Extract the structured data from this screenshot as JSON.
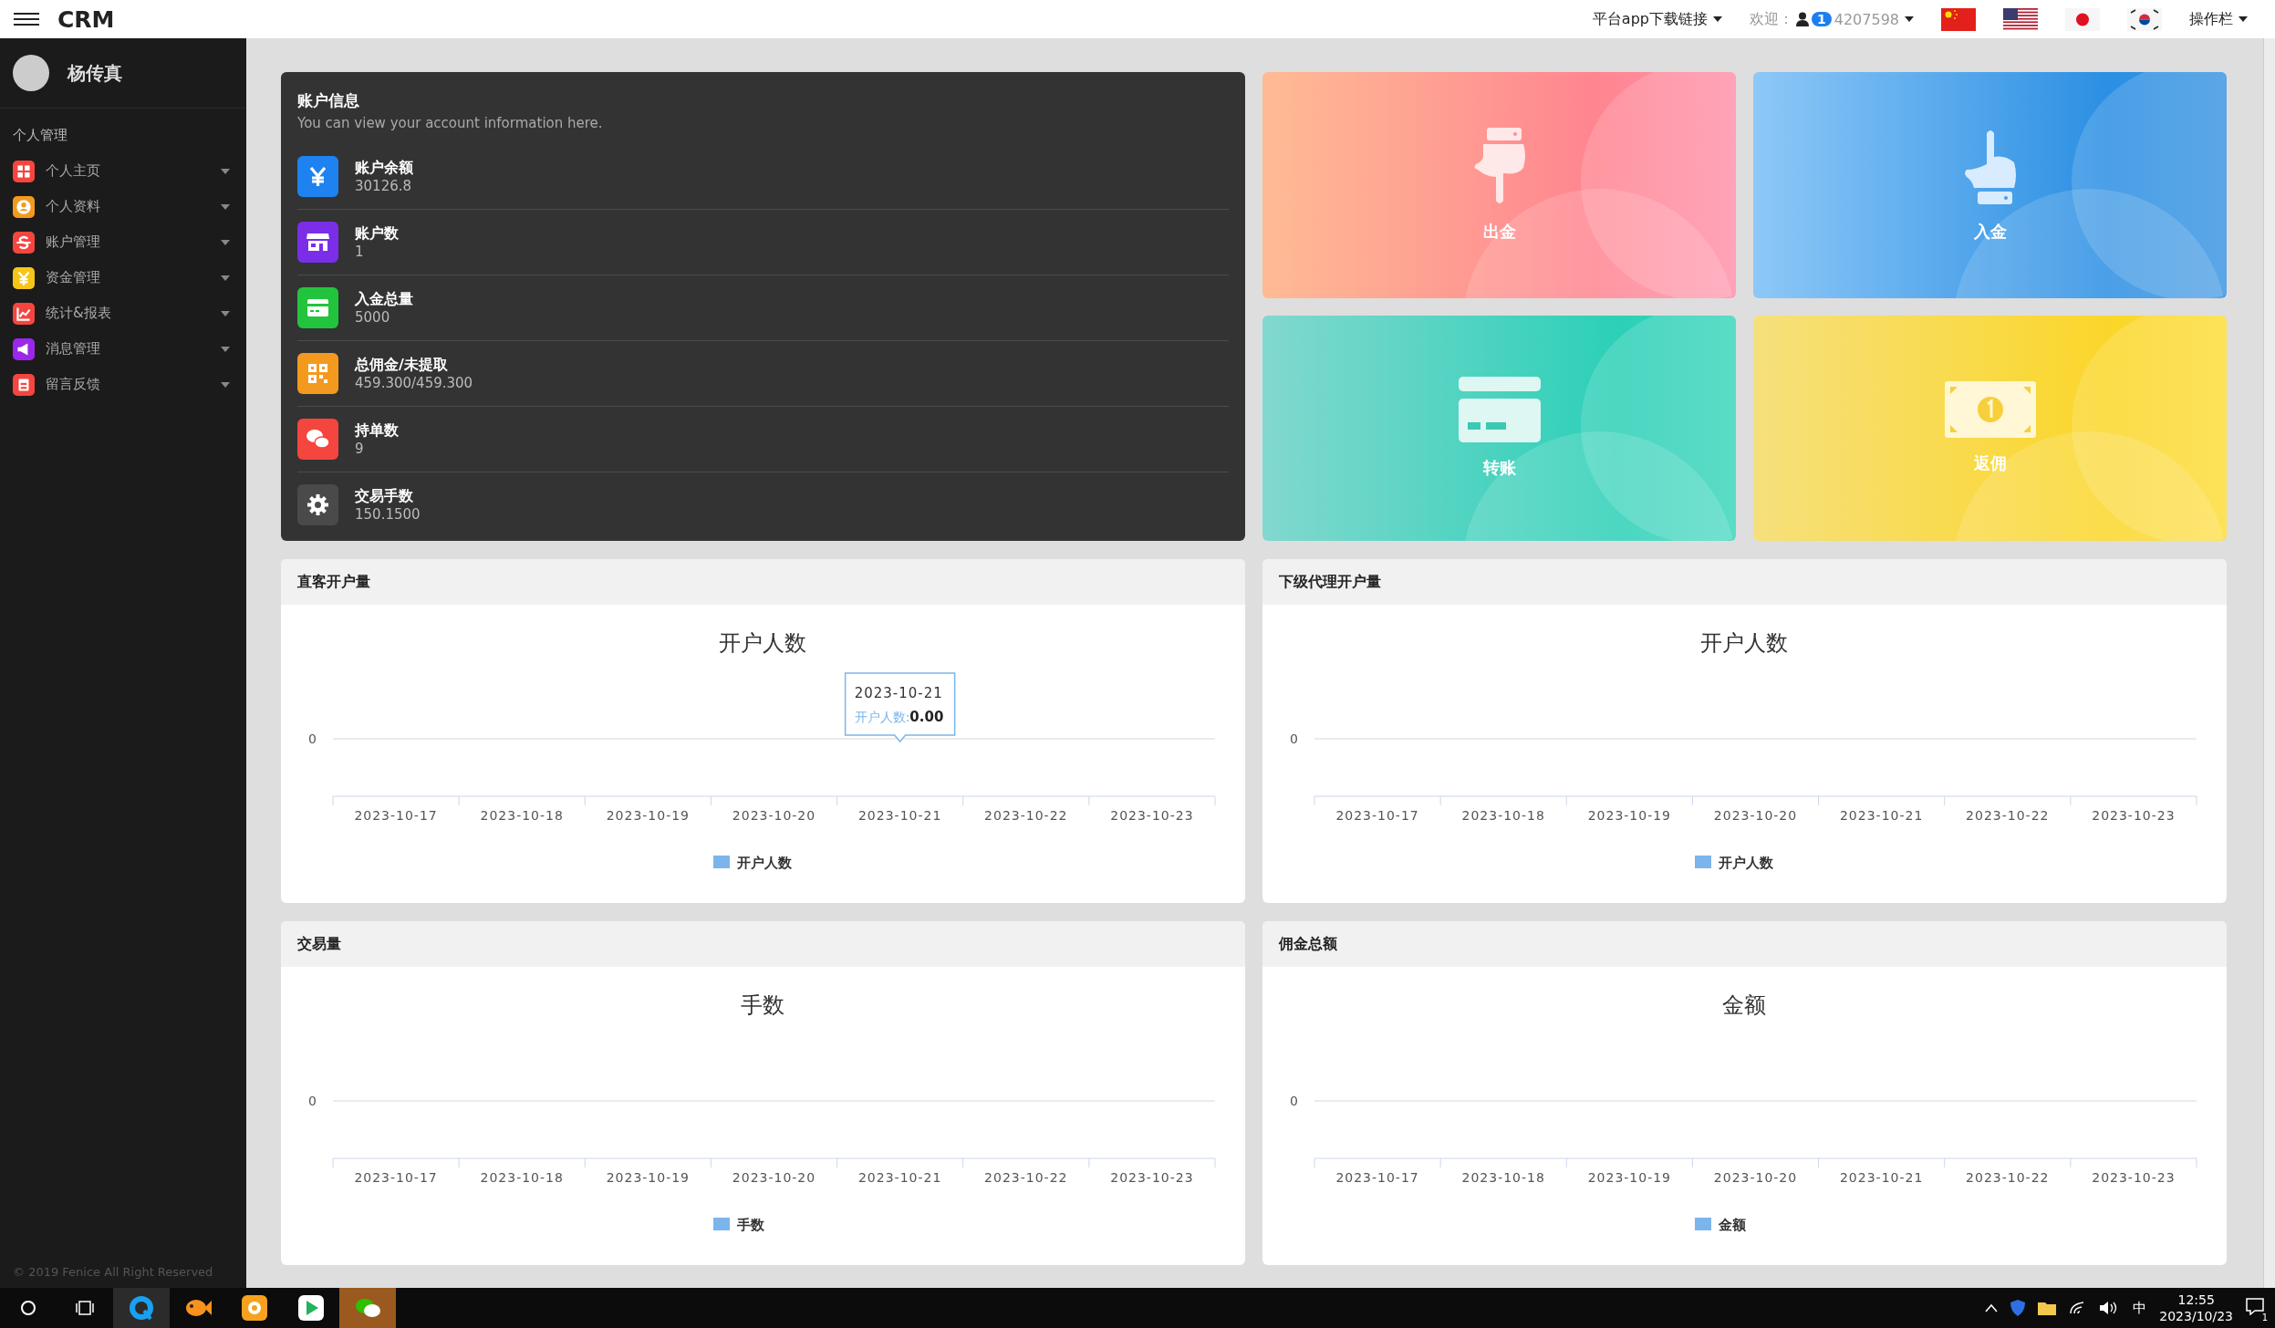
{
  "topbar": {
    "title": "CRM",
    "download": "平台app下载链接",
    "welcome": "欢迎：",
    "badge": "1",
    "user": "4207598",
    "flags": [
      {
        "kind": "cn"
      },
      {
        "kind": "us"
      },
      {
        "kind": "jp"
      },
      {
        "kind": "kr"
      }
    ],
    "menu": "操作栏"
  },
  "sidebar": {
    "user": "杨传真",
    "section": "个人管理",
    "items": [
      {
        "label": "个人主页",
        "kind": "grid",
        "color": "#f5453f"
      },
      {
        "label": "个人资料",
        "kind": "person",
        "color": "#f39a1e"
      },
      {
        "label": "账户管理",
        "kind": "dollar",
        "color": "#f5453f"
      },
      {
        "label": "资金管理",
        "kind": "yen",
        "color": "#f5c518"
      },
      {
        "label": "统计&报表",
        "kind": "chart",
        "color": "#f5453f"
      },
      {
        "label": "消息管理",
        "kind": "megaphone",
        "color": "#9b27e8"
      },
      {
        "label": "留言反馈",
        "kind": "note",
        "color": "#f5453f"
      }
    ],
    "footer": "© 2019 Fenice All Right Reserved"
  },
  "account": {
    "title": "账户信息",
    "subtitle": "You can view your account information here.",
    "items": [
      {
        "label": "账户余额",
        "value": "30126.8",
        "kind": "yen",
        "color": "#1e82f0"
      },
      {
        "label": "账户数",
        "value": "1",
        "kind": "store",
        "color": "#7a2ee8"
      },
      {
        "label": "入金总量",
        "value": "5000",
        "kind": "card",
        "color": "#22c43d"
      },
      {
        "label": "总佣金/未提取",
        "value": "459.300/459.300",
        "kind": "qr",
        "color": "#f39a1e"
      },
      {
        "label": "持单数",
        "value": "9",
        "kind": "chat",
        "color": "#f5453f"
      },
      {
        "label": "交易手数",
        "value": "150.1500",
        "kind": "gear",
        "color": "#4a4a4a"
      }
    ]
  },
  "actions": [
    {
      "label": "出金",
      "kind": "withdraw"
    },
    {
      "label": "入金",
      "kind": "deposit"
    },
    {
      "label": "转账",
      "kind": "transfer"
    },
    {
      "label": "返佣",
      "kind": "rebate"
    }
  ],
  "charts": [
    {
      "title": "直客开户量",
      "chart_title": "开户人数",
      "y_axis_label": "0",
      "x_labels": [
        "2023-10-17",
        "2023-10-18",
        "2023-10-19",
        "2023-10-20",
        "2023-10-21",
        "2023-10-22",
        "2023-10-23"
      ],
      "legend": "开户人数",
      "tooltip": {
        "date": "2023-10-21",
        "label": "开户人数:",
        "value": "0.00"
      }
    },
    {
      "title": "下级代理开户量",
      "chart_title": "开户人数",
      "y_axis_label": "0",
      "x_labels": [
        "2023-10-17",
        "2023-10-18",
        "2023-10-19",
        "2023-10-20",
        "2023-10-21",
        "2023-10-22",
        "2023-10-23"
      ],
      "legend": "开户人数"
    },
    {
      "title": "交易量",
      "chart_title": "手数",
      "y_axis_label": "0",
      "x_labels": [
        "2023-10-17",
        "2023-10-18",
        "2023-10-19",
        "2023-10-20",
        "2023-10-21",
        "2023-10-22",
        "2023-10-23"
      ],
      "legend": "手数"
    },
    {
      "title": "佣金总额",
      "chart_title": "金额",
      "y_axis_label": "0",
      "x_labels": [
        "2023-10-17",
        "2023-10-18",
        "2023-10-19",
        "2023-10-20",
        "2023-10-21",
        "2023-10-22",
        "2023-10-23"
      ],
      "legend": "金额"
    }
  ],
  "taskbar": {
    "ime": "中",
    "time": "12:55",
    "date": "2023/10/23",
    "notifications": "1"
  }
}
